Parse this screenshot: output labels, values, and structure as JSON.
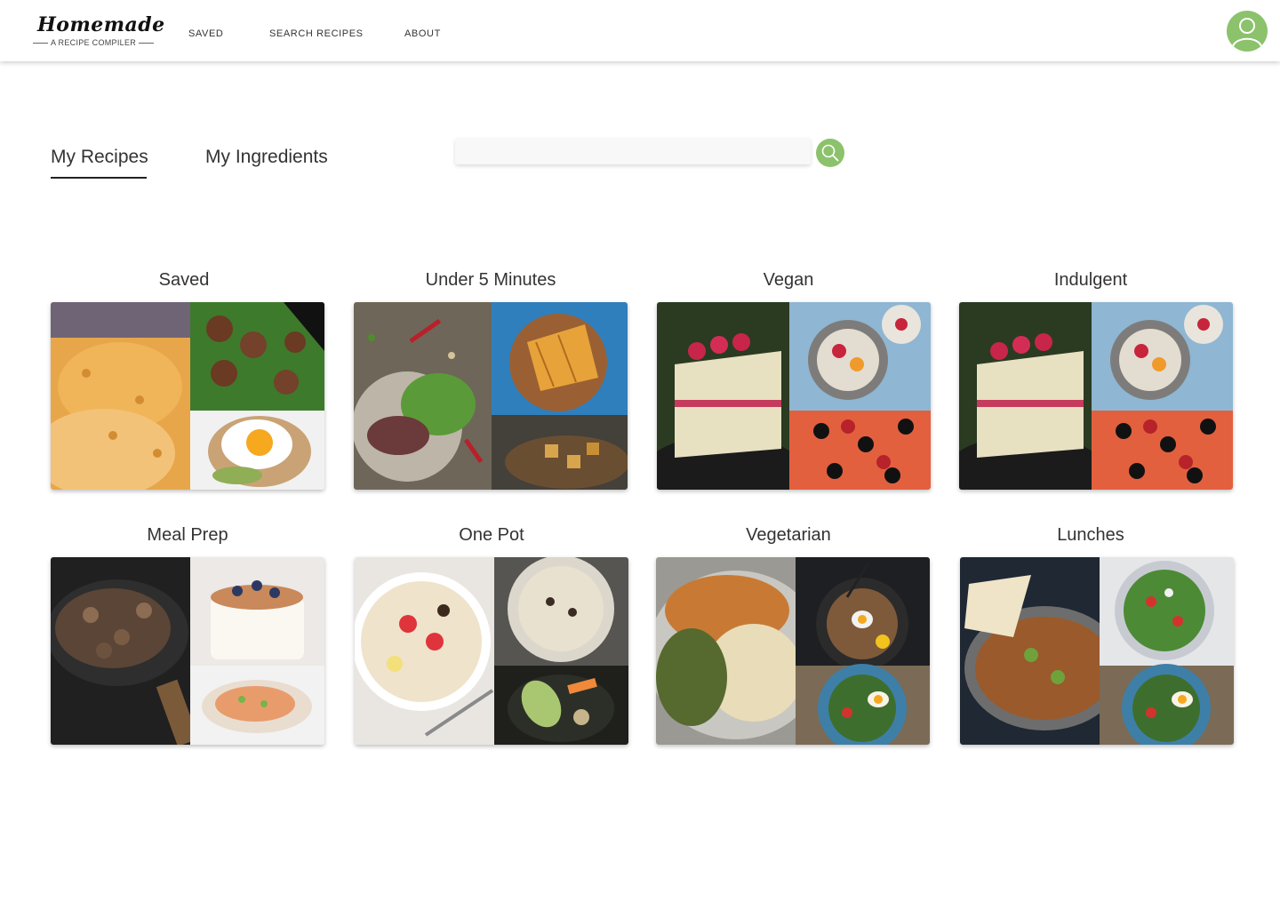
{
  "app": {
    "logo_title": "Homemade",
    "logo_subtitle": "A RECIPE COMPILER"
  },
  "nav": {
    "items": [
      {
        "label": "SAVED"
      },
      {
        "label": "SEARCH RECIPES"
      },
      {
        "label": "ABOUT"
      }
    ]
  },
  "tabs": [
    {
      "label": "My Recipes",
      "active": true
    },
    {
      "label": "My Ingredients",
      "active": false
    }
  ],
  "search": {
    "value": "",
    "placeholder": ""
  },
  "collections": [
    {
      "title": "Saved",
      "thumbs": [
        "mac-and-cheese",
        "meatballs-with-spinach",
        "egg-on-toast"
      ]
    },
    {
      "title": "Under 5 Minutes",
      "thumbs": [
        "steak-salad",
        "grilled-sandwich",
        "roasted-potatoes"
      ]
    },
    {
      "title": "Vegan",
      "thumbs": [
        "raspberry-cake",
        "fruit-bowl",
        "pepperoni-pizza"
      ]
    },
    {
      "title": "Indulgent",
      "thumbs": [
        "raspberry-cake",
        "fruit-bowl",
        "pepperoni-pizza"
      ]
    },
    {
      "title": "Meal Prep",
      "thumbs": [
        "mushroom-skillet",
        "blueberry-cake",
        "salmon-fillet"
      ]
    },
    {
      "title": "One Pot",
      "thumbs": [
        "smoothie-bowl",
        "creamy-soup",
        "vegetable-broth"
      ]
    },
    {
      "title": "Vegetarian",
      "thumbs": [
        "beans-and-rice",
        "ramen-bowl",
        "egg-salad-bowl"
      ]
    },
    {
      "title": "Lunches",
      "thumbs": [
        "curry-with-naan",
        "green-salad",
        "egg-salad-bowl"
      ]
    }
  ],
  "colors": {
    "accent_green": "#8bc26b",
    "header_background": "#ffffff",
    "text": "#333333"
  }
}
